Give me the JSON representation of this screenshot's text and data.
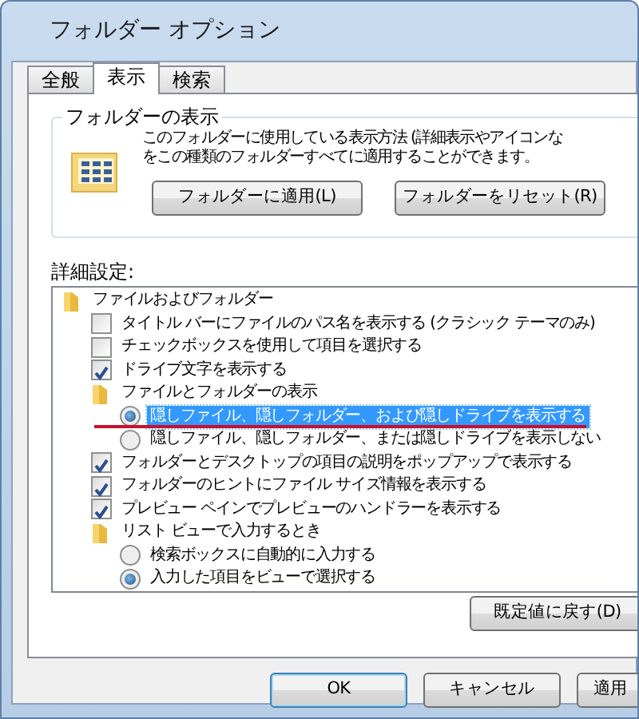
{
  "window": {
    "title": "フォルダー オプション"
  },
  "tabs": [
    {
      "label": "全般",
      "selected": false
    },
    {
      "label": "表示",
      "selected": true
    },
    {
      "label": "検索",
      "selected": false
    }
  ],
  "folder_views": {
    "title": "フォルダーの表示",
    "description": [
      "このフォルダーに使用している表示方法 (詳細表示やアイコンな",
      "をこの種類のフォルダーすべてに適用することができます。"
    ],
    "buttons": [
      "フォルダーに適用(L)",
      "フォルダーをリセット(R)"
    ]
  },
  "advanced": {
    "label": "詳細設定:",
    "tree": [
      {
        "kind": "folder",
        "label": "ファイルおよびフォルダー",
        "selected": false,
        "children": [
          {
            "kind": "checkbox",
            "label": "タイトル バーにファイルのパス名を表示する (クラシック テーマのみ)",
            "checked": false,
            "selected": false
          },
          {
            "kind": "checkbox",
            "label": "チェックボックスを使用して項目を選択する",
            "checked": false,
            "selected": false
          },
          {
            "kind": "checkbox",
            "label": "ドライブ文字を表示する",
            "checked": true,
            "selected": false
          },
          {
            "kind": "folder",
            "label": "ファイルとフォルダーの表示",
            "selected": false,
            "children": [
              {
                "kind": "radio",
                "label": "隠しファイル、隠しフォルダー、および隠しドライブを表示する",
                "checked": true,
                "selected": true,
                "underlined": true
              },
              {
                "kind": "radio",
                "label": "隠しファイル、隠しフォルダー、または隠しドライブを表示しない",
                "checked": false,
                "selected": false
              }
            ]
          },
          {
            "kind": "checkbox",
            "label": "フォルダーとデスクトップの項目の説明をポップアップで表示する",
            "checked": true,
            "selected": false
          },
          {
            "kind": "checkbox",
            "label": "フォルダーのヒントにファイル サイズ情報を表示する",
            "checked": true,
            "selected": false
          },
          {
            "kind": "checkbox",
            "label": "プレビュー ペインでプレビューのハンドラーを表示する",
            "checked": true,
            "selected": false
          },
          {
            "kind": "folder",
            "label": "リスト ビューで入力するとき",
            "selected": false,
            "children": [
              {
                "kind": "radio",
                "label": "検索ボックスに自動的に入力する",
                "checked": false,
                "selected": false
              },
              {
                "kind": "radio",
                "label": "入力した項目をビューで選択する",
                "checked": true,
                "selected": false
              }
            ]
          }
        ]
      }
    ],
    "restore_button": "既定値に戻す(D)"
  },
  "dialog_buttons": [
    {
      "label": "OK",
      "default": true
    },
    {
      "label": "キャンセル",
      "default": false
    },
    {
      "label": "適用",
      "default": false
    }
  ]
}
